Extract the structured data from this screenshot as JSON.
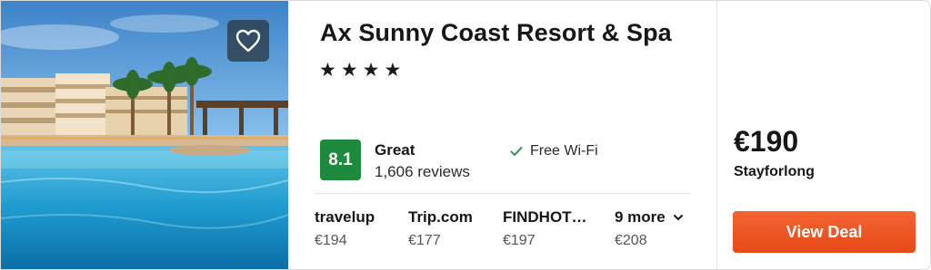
{
  "hotel": {
    "name": "Ax Sunny Coast Resort & Spa",
    "stars_text": "★★★★",
    "star_count": 4,
    "rating": {
      "score": "8.1",
      "label": "Great",
      "reviews": "1,606 reviews",
      "color": "#1e8a3d"
    },
    "amenity": "Free Wi-Fi"
  },
  "providers": [
    {
      "name": "travelup",
      "price": "€194"
    },
    {
      "name": "Trip.com",
      "price": "€177"
    },
    {
      "name": "FINDHOT…",
      "price": "€197"
    }
  ],
  "more": {
    "label": "9 more",
    "price": "€208"
  },
  "deal": {
    "price": "€190",
    "provider": "Stayforlong",
    "button_label": "View Deal",
    "button_color": "#f0592a"
  },
  "icons": {
    "favorite": "heart-icon",
    "amenity": "checkmark-icon",
    "more": "chevron-down-icon"
  }
}
